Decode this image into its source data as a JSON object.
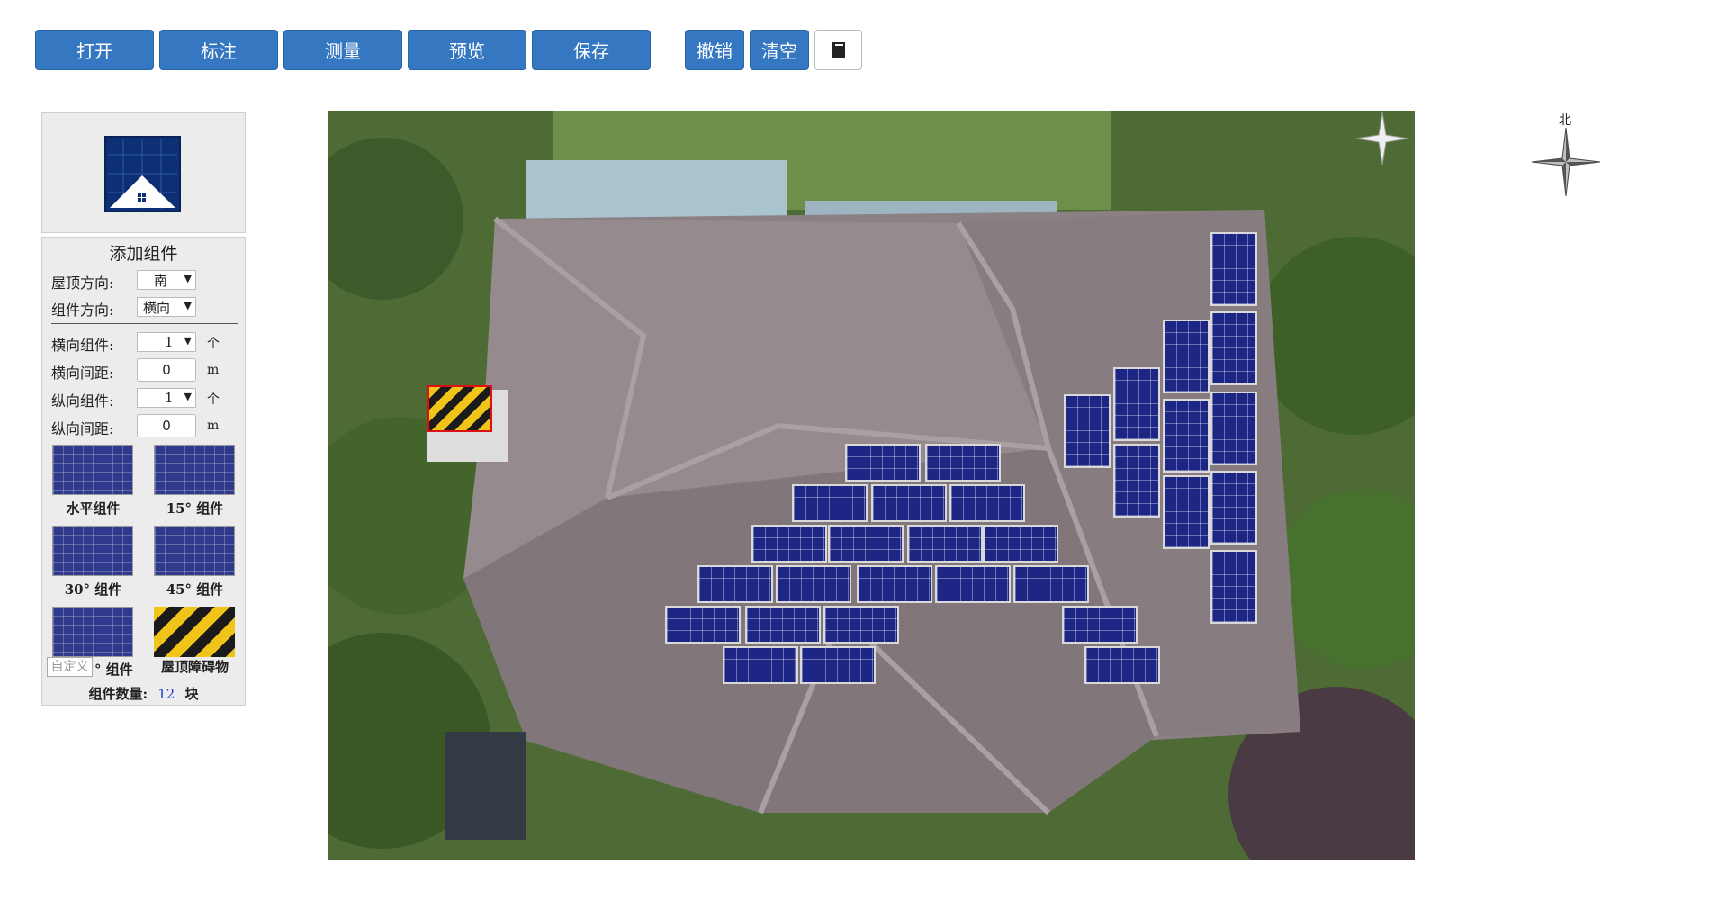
{
  "toolbar": {
    "open": "打开",
    "annotate": "标注",
    "measure": "测量",
    "preview": "预览",
    "save": "保存",
    "undo": "撤销",
    "clear": "清空",
    "book_icon": "book-icon"
  },
  "panel": {
    "title": "添加组件",
    "roof_direction_label": "屋顶方向:",
    "roof_direction_value": "南",
    "module_direction_label": "组件方向:",
    "module_direction_value": "横向",
    "h_count_label": "横向组件:",
    "h_count_value": "1",
    "h_count_unit": "个",
    "h_gap_label": "横向间距:",
    "h_gap_value": "0",
    "h_gap_unit": "m",
    "v_count_label": "纵向组件:",
    "v_count_value": "1",
    "v_count_unit": "个",
    "v_gap_label": "纵向间距:",
    "v_gap_value": "0",
    "v_gap_unit": "m",
    "tiles": {
      "horizontal": "水平组件",
      "deg15": "15° 组件",
      "deg30": "30° 组件",
      "deg45": "45° 组件",
      "custom_placeholder": "自定义",
      "custom_suffix": "° 组件",
      "obstacle": "屋顶障碍物"
    },
    "count_label": "组件数量:",
    "count_value": "12",
    "count_unit": "块"
  },
  "compass": {
    "north": "北",
    "icon": "compass-rose-icon"
  },
  "colors": {
    "accent": "#3577c0",
    "panel_blue": "#1d2585",
    "obstacle_yellow": "#f0c419"
  }
}
